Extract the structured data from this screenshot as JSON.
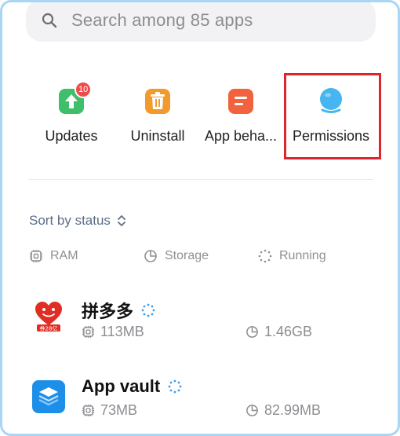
{
  "search": {
    "placeholder": "Search among 85 apps"
  },
  "tools": [
    {
      "label": "Updates",
      "icon": "updates-icon",
      "badge": "10",
      "color": "#3fbf6a"
    },
    {
      "label": "Uninstall",
      "icon": "trash-icon",
      "color": "#f39a2c"
    },
    {
      "label": "App beha...",
      "icon": "app-behavior-icon",
      "color": "#f2623f"
    },
    {
      "label": "Permissions",
      "icon": "permissions-icon",
      "color": "#45b6f2"
    }
  ],
  "highlighted_tool": "Permissions",
  "sort": {
    "label": "Sort by status"
  },
  "filters": [
    {
      "label": "RAM",
      "icon": "ram-icon"
    },
    {
      "label": "Storage",
      "icon": "storage-icon"
    },
    {
      "label": "Running",
      "icon": "running-icon"
    }
  ],
  "apps": [
    {
      "name": "拼多多",
      "ram": "113MB",
      "storage": "1.46GB",
      "icon": "pinduoduo-app-icon",
      "icon_text": "券28亿"
    },
    {
      "name": "App vault",
      "ram": "73MB",
      "storage": "82.99MB",
      "icon": "app-vault-app-icon"
    }
  ],
  "colors": {
    "accent_blue": "#3f9be8",
    "highlight_red": "#e0242b",
    "frame_border": "#a9d6f5"
  }
}
